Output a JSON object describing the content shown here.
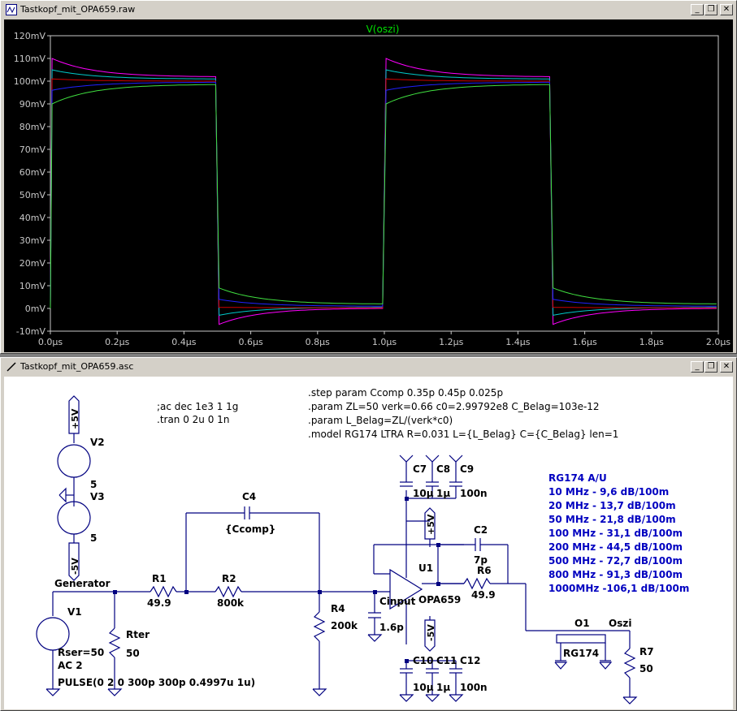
{
  "plot_window": {
    "title": "Tastkopf_mit_OPA659.raw",
    "trace_label": "V(oszi)",
    "colors": {
      "background": "#000000",
      "axis": "#c8c8c8",
      "trace_label": "#00e000"
    }
  },
  "schematic_window": {
    "title": "Tastkopf_mit_OPA659.asc",
    "directives_left": [
      ";ac dec 1e3 1 1g",
      ".tran 0 2u 0 1n"
    ],
    "directives_right": [
      ".step param Ccomp 0.35p 0.45p 0.025p",
      ".param ZL=50 verk=0.66 c0=2.99792e8 C_Belag=103e-12",
      ".param L_Belag=ZL/(verk*c0)",
      ".model RG174 LTRA R=0.031 L={L_Belag} C={C_Belag} len=1"
    ],
    "attenuation_table": [
      "RG174 A/U",
      "10 MHz - 9,6 dB/100m",
      "20 MHz - 13,7 dB/100m",
      "50 MHz - 21,8 dB/100m",
      "100 MHz - 31,1 dB/100m",
      "200 MHz - 44,5 dB/100m",
      "500 MHz - 72,7 dB/100m",
      "800 MHz - 91,3 dB/100m",
      "1000MHz -106,1 dB/100m"
    ],
    "labels": {
      "pos5v": "+5V",
      "neg5v": "-5V",
      "v2": "V2",
      "v2_val": "5",
      "v3": "V3",
      "v3_val": "5",
      "generator": "Generator",
      "v1": "V1",
      "v1_rser": "Rser=50",
      "v1_ac": "AC 2",
      "v1_pulse": "PULSE(0 2 0 300p 300p 0.4997u 1u)",
      "rter": "Rter",
      "rter_val": "50",
      "r1": "R1",
      "r1_val": "49.9",
      "r2": "R2",
      "r2_val": "800k",
      "c4": "C4",
      "c4_val": "{Ccomp}",
      "r4": "R4",
      "r4_val": "200k",
      "cinput": "Cinput",
      "cinput_val": "1.6p",
      "c7": "C7",
      "c8": "C8",
      "c9": "C9",
      "c7_val": "10µ",
      "c8_val": "1µ",
      "c9_val": "100n",
      "c10": "C10",
      "c11": "C11",
      "c12": "C12",
      "c10_val": "10µ",
      "c11_val": "1µ",
      "c12_val": "100n",
      "c2": "C2",
      "c2_val": "7p",
      "u1": "U1",
      "u1_model": "OPA659",
      "r6": "R6",
      "r6_val": "49.9",
      "o1": "O1",
      "o1_model": "RG174",
      "oszi": "Oszi",
      "r7": "R7",
      "r7_val": "50"
    },
    "colors": {
      "wire": "#000080",
      "text": "#000000",
      "table_text": "#0000c0",
      "background": "#ffffff"
    }
  },
  "chart_data": {
    "type": "line",
    "title": "V(oszi)",
    "xlabel": "",
    "ylabel": "",
    "xlim": [
      0,
      2.0
    ],
    "ylim": [
      -10,
      120
    ],
    "x_ticks": [
      "0.0µs",
      "0.2µs",
      "0.4µs",
      "0.6µs",
      "0.8µs",
      "1.0µs",
      "1.2µs",
      "1.4µs",
      "1.6µs",
      "1.8µs",
      "2.0µs"
    ],
    "y_ticks": [
      "-10mV",
      "0mV",
      "10mV",
      "20mV",
      "30mV",
      "40mV",
      "50mV",
      "60mV",
      "70mV",
      "80mV",
      "90mV",
      "100mV",
      "110mV",
      "120mV"
    ],
    "x_units": "µs",
    "y_units": "mV",
    "series": [
      {
        "color": "#ff00ff",
        "high_start": 110,
        "high_end": 102,
        "low_start": -7,
        "low_end": 0
      },
      {
        "color": "#00c8c8",
        "high_start": 105,
        "high_end": 101,
        "low_start": -3,
        "low_end": 0.5
      },
      {
        "color": "#d00000",
        "high_start": 101,
        "high_end": 100,
        "low_start": 0.5,
        "low_end": 0.3
      },
      {
        "color": "#2020ff",
        "high_start": 96,
        "high_end": 99.5,
        "low_start": 4,
        "low_end": 1
      },
      {
        "color": "#40e040",
        "high_start": 90,
        "high_end": 98.5,
        "low_start": 9,
        "low_end": 2
      }
    ]
  }
}
